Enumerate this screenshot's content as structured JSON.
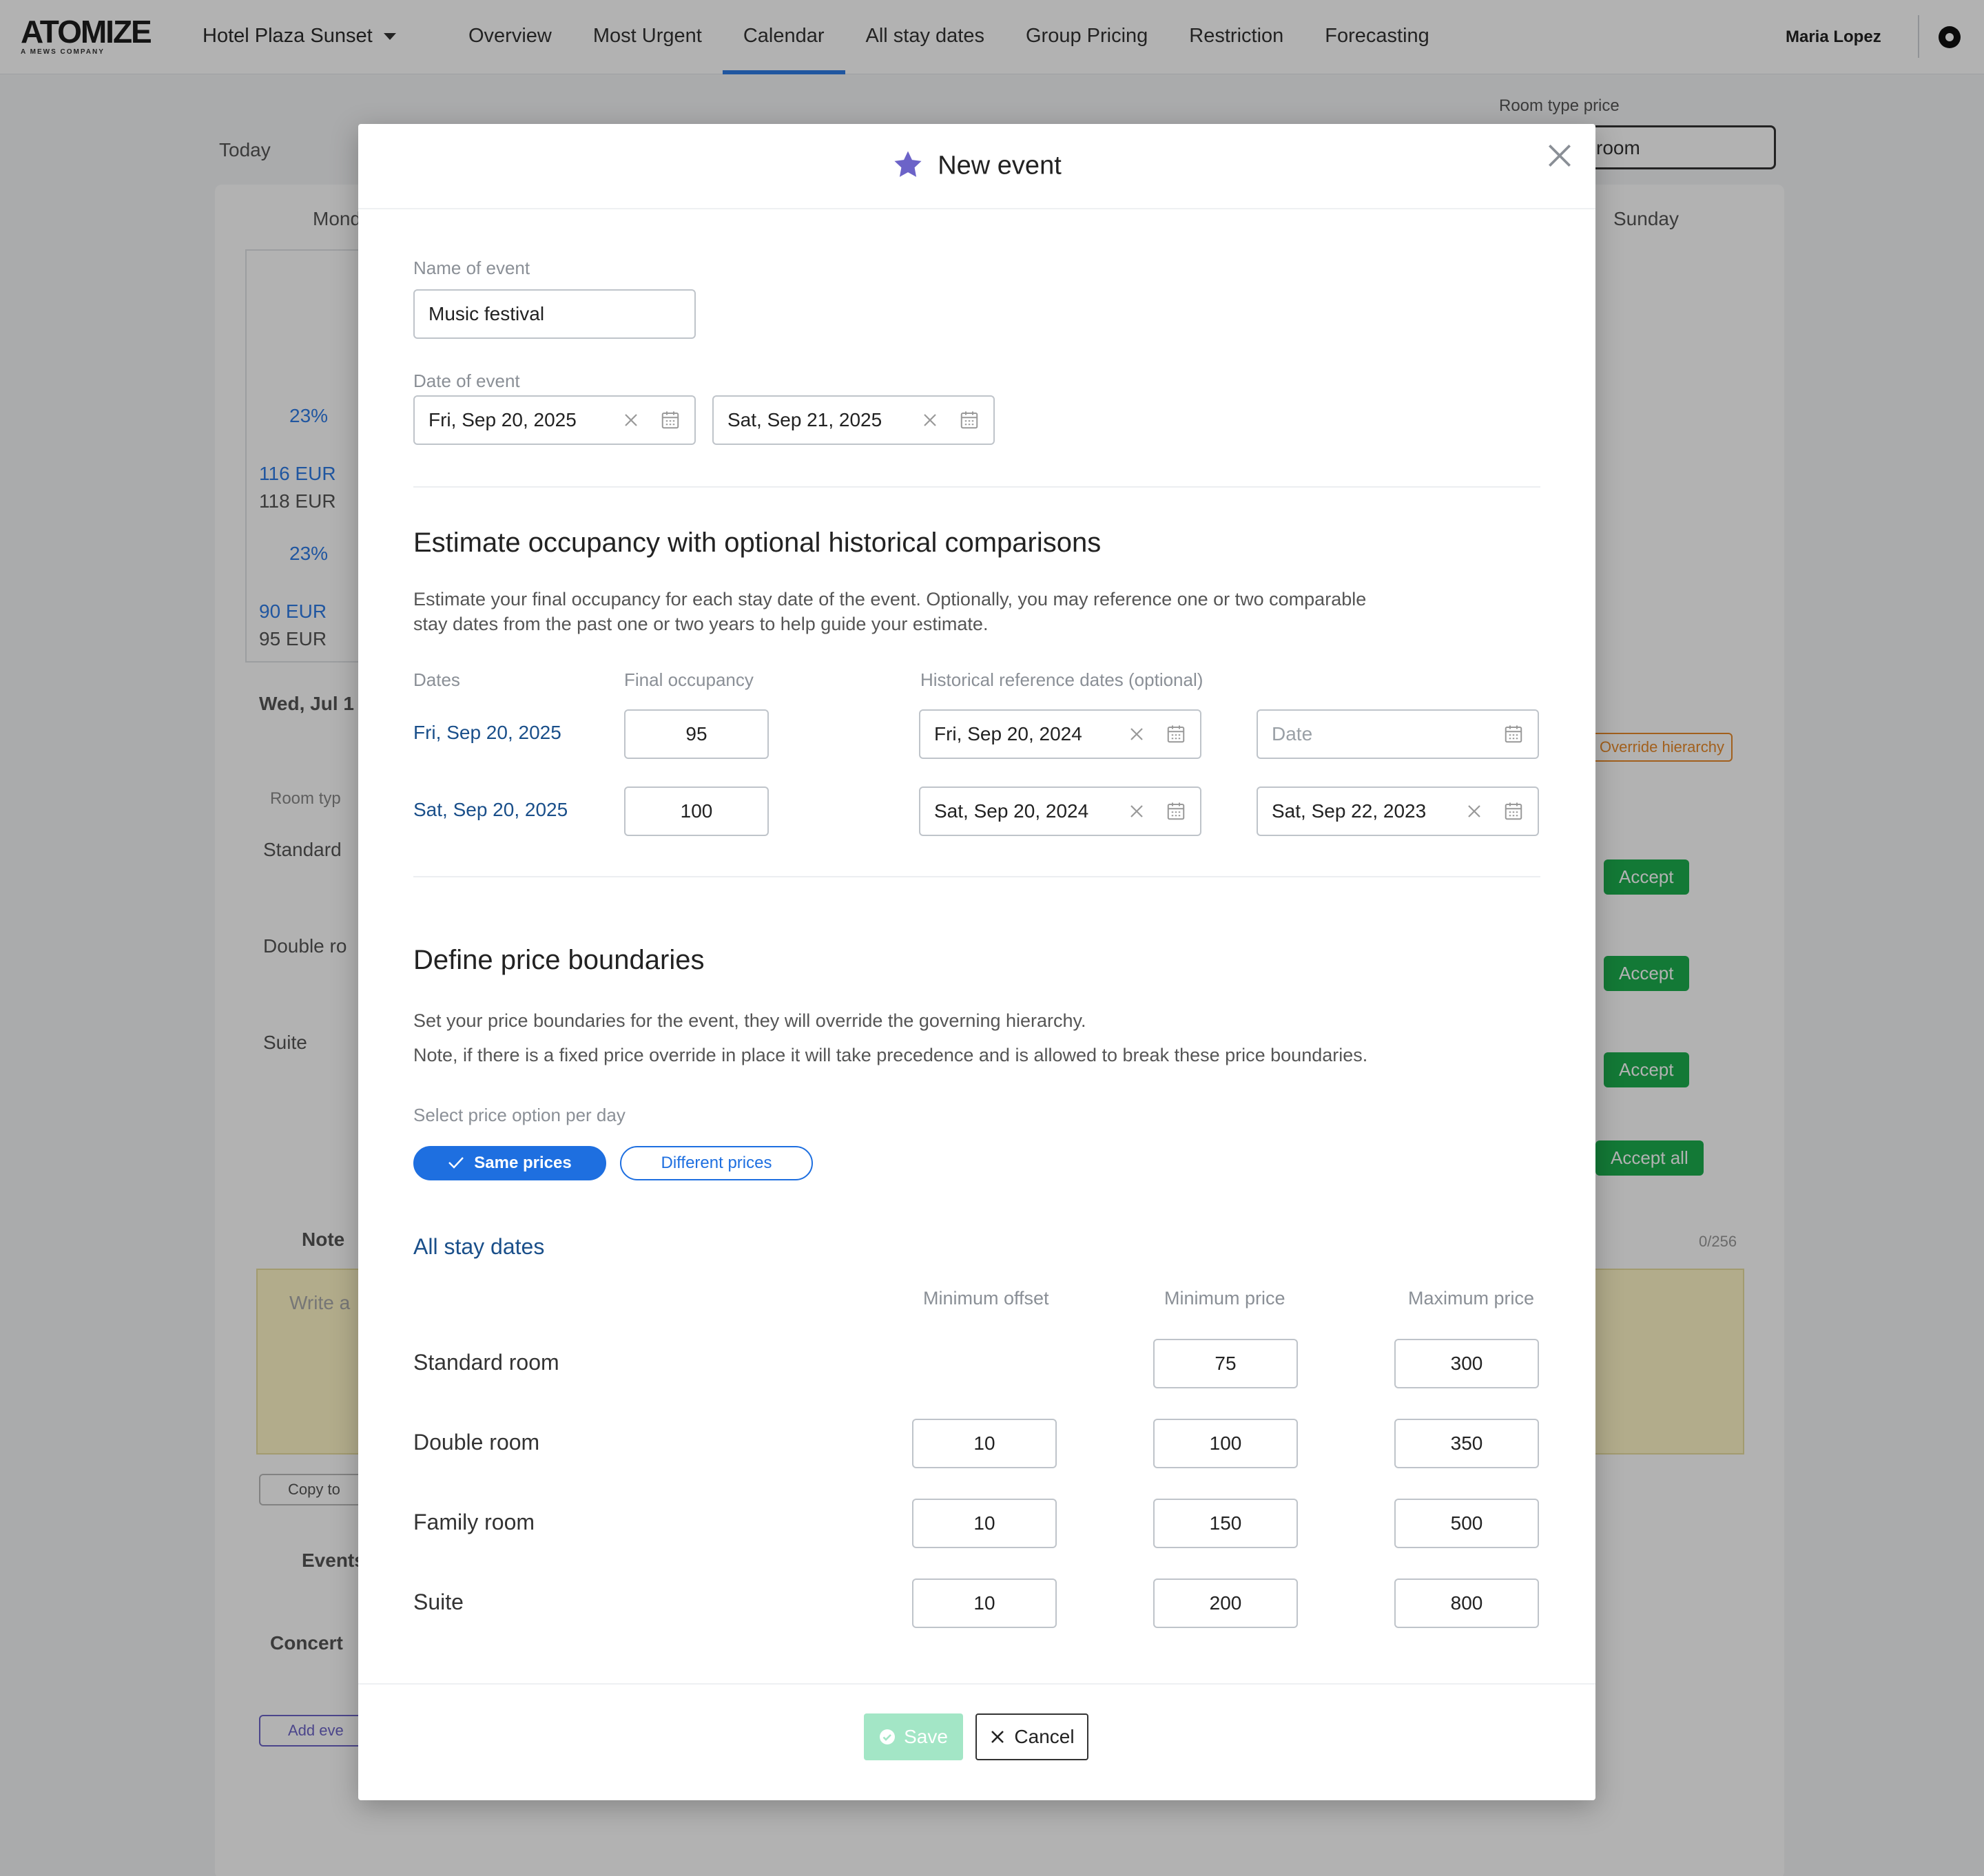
{
  "app": {
    "logo": "ATOMIZE",
    "logo_sub": "A MEWS COMPANY",
    "hotel": "Hotel Plaza Sunset",
    "nav": [
      "Overview",
      "Most Urgent",
      "Calendar",
      "All stay dates",
      "Group Pricing",
      "Restriction",
      "Forecasting"
    ],
    "active_nav": "Calendar",
    "user": "Maria Lopez",
    "room_type_price_label": "Room type price",
    "room_type_price_value": "room",
    "today": "Today",
    "day_left": "Mond",
    "day_right": "Sunday",
    "bg_values": {
      "pct": "23%",
      "price_a": "116 EUR",
      "price_b": "118 EUR",
      "price_c": "90 EUR",
      "price_d": "95 EUR",
      "date": "Wed, Jul 1",
      "room_type": "Room typ",
      "standard": "Standard",
      "double": "Double ro",
      "suite": "Suite",
      "note": "Note",
      "note_placeholder": "Write a",
      "copy": "Copy to",
      "events": "Events",
      "concert": "Concert",
      "add_event": "Add eve",
      "accept": "Accept",
      "accept_all": "Accept all",
      "override": "Override hierarchy",
      "counter": "0/256"
    },
    "accent_color": "#2f7be5"
  },
  "modal": {
    "title": "New event",
    "name_label": "Name of event",
    "name_value": "Music festival",
    "date_label": "Date of event",
    "date_start": "Fri, Sep 20, 2025",
    "date_end": "Sat, Sep 21, 2025",
    "occupancy": {
      "title": "Estimate occupancy with optional historical comparisons",
      "desc_line1": "Estimate your final occupancy for each stay date of the event. Optionally, you may reference one or two comparable",
      "desc_line2": "stay dates from the past one or two years to help guide your estimate.",
      "col_dates": "Dates",
      "col_final": "Final occupancy",
      "col_hist": "Historical reference dates (optional)",
      "date_placeholder": "Date",
      "rows": [
        {
          "date": "Fri, Sep 20, 2025",
          "final": "95",
          "ref1": "Fri, Sep 20, 2024",
          "ref2": ""
        },
        {
          "date": "Sat, Sep 20, 2025",
          "final": "100",
          "ref1": "Sat, Sep 20, 2024",
          "ref2": "Sat, Sep 22, 2023"
        }
      ]
    },
    "price": {
      "title": "Define price boundaries",
      "desc_line1": "Set your price boundaries for the event, they will override the governing hierarchy.",
      "desc_line2": "Note, if there is a fixed price override in place it will take precedence and is allowed to break these price boundaries.",
      "option_label": "Select price option per day",
      "opt_same": "Same prices",
      "opt_diff": "Different prices",
      "selected_option": "Same prices",
      "section": "All stay dates",
      "col_offset": "Minimum offset",
      "col_min": "Minimum price",
      "col_max": "Maximum price",
      "rooms": [
        {
          "name": "Standard room",
          "offset": "",
          "min": "75",
          "max": "300"
        },
        {
          "name": "Double room",
          "offset": "10",
          "min": "100",
          "max": "350"
        },
        {
          "name": "Family room",
          "offset": "10",
          "min": "150",
          "max": "500"
        },
        {
          "name": "Suite",
          "offset": "10",
          "min": "200",
          "max": "800"
        }
      ]
    },
    "save": "Save",
    "cancel": "Cancel",
    "colors": {
      "primary": "#1e6fe0",
      "save_disabled": "#a3e6c6",
      "star": "#6c63c8",
      "link": "#1a4f8a"
    }
  }
}
